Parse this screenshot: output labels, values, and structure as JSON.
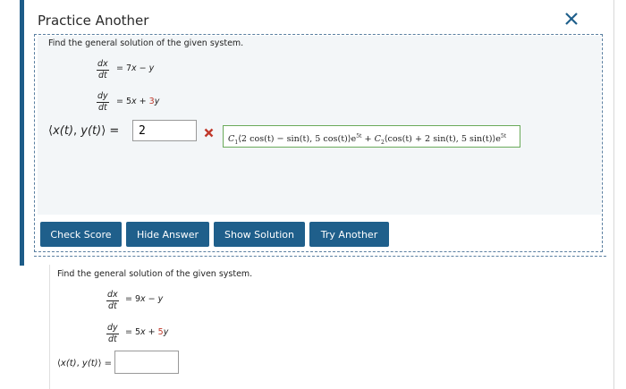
{
  "header": {
    "title": "Practice Another"
  },
  "problem1": {
    "prompt": "Find the general solution of the given system.",
    "eq1": {
      "num": "dx",
      "den": "dt",
      "rhs_a": "= 7",
      "var_a": "x",
      "rhs_b": " − ",
      "var_b": "y"
    },
    "eq2": {
      "num": "dy",
      "den": "dt",
      "rhs_a": "= 5",
      "var_a": "x",
      "rhs_plus": " + ",
      "coef": "3",
      "var_b": "y"
    },
    "vector_label_open": "⟨",
    "vector_x": "x(t)",
    "vector_sep": ", ",
    "vector_y": "y(t)",
    "vector_label_close": "⟩  =",
    "answer_value": "2",
    "correct_answer": {
      "c1": "C",
      "c1_sub": "1",
      "part1": "⟨2 cos(t) − sin(t), 5 cos(t)⟩e",
      "exp1": "5t",
      "plus": " + ",
      "c2": "C",
      "c2_sub": "2",
      "part2": "⟨cos(t) + 2 sin(t), 5 sin(t)⟩e",
      "exp2": "5t"
    }
  },
  "buttons": {
    "check_score": "Check Score",
    "hide_answer": "Hide Answer",
    "show_solution": "Show Solution",
    "try_another": "Try Another"
  },
  "problem2": {
    "prompt": "Find the general solution of the given system.",
    "eq1": {
      "num": "dx",
      "den": "dt",
      "rhs_a": "= 9",
      "var_a": "x",
      "rhs_b": " − ",
      "var_b": "y"
    },
    "eq2": {
      "num": "dy",
      "den": "dt",
      "rhs_a": "= 5",
      "var_a": "x",
      "rhs_plus": " + ",
      "coef": "5",
      "var_b": "y"
    },
    "vector_label_open": "⟨",
    "vector_x": "x(t)",
    "vector_sep": ", ",
    "vector_y": "y(t)",
    "vector_label_close": "⟩  =",
    "answer_value": ""
  },
  "colors": {
    "accent": "#1f5f8b",
    "wrong": "#c0392b",
    "correct_border": "#6aaa5a",
    "coef_highlight": "#c0392b"
  },
  "icons": {
    "close": "close-icon",
    "wrong": "wrong-x-icon"
  }
}
